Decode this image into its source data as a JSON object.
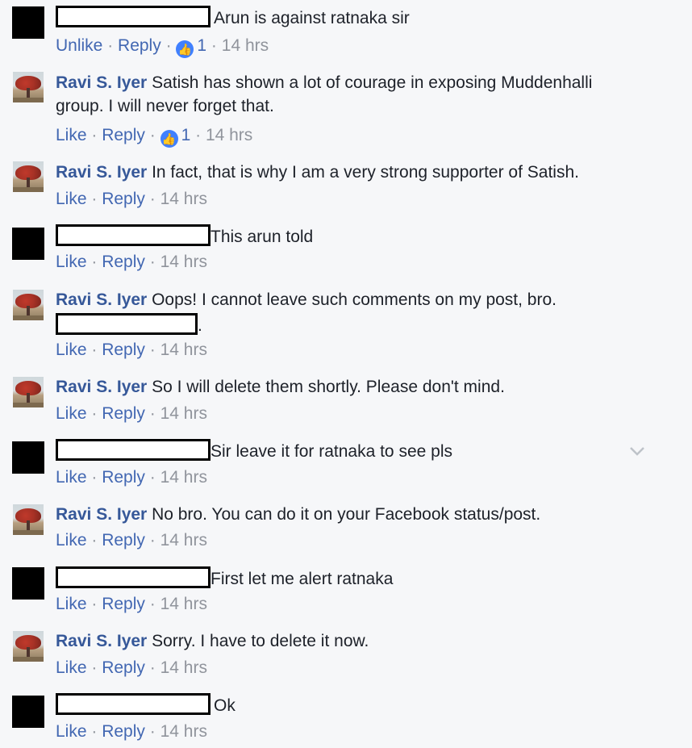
{
  "comments": [
    {
      "author": "",
      "text": "Arun is against ratnaka sir",
      "like": "Unlike",
      "reply": "Reply",
      "likes": "1",
      "time": "14 hrs"
    },
    {
      "author": "Ravi S. Iyer",
      "text": "Satish has shown a lot of courage in exposing Muddenhalli",
      "text2": "group. I will never forget that.",
      "like": "Like",
      "reply": "Reply",
      "likes": "1",
      "time": "14 hrs"
    },
    {
      "author": "Ravi S. Iyer",
      "text": "In fact, that is why I am a very strong supporter of Satish.",
      "like": "Like",
      "reply": "Reply",
      "time": "14 hrs"
    },
    {
      "author": "",
      "text": "This arun told",
      "like": "Like",
      "reply": "Reply",
      "time": "14 hrs"
    },
    {
      "author": "Ravi S. Iyer",
      "text": "Oops! I cannot leave such comments on my post, bro.",
      "text2": ".",
      "like": "Like",
      "reply": "Reply",
      "time": "14 hrs"
    },
    {
      "author": "Ravi S. Iyer",
      "text": "So I will delete them shortly. Please don't mind.",
      "like": "Like",
      "reply": "Reply",
      "time": "14 hrs"
    },
    {
      "author": "",
      "text": "Sir leave it for ratnaka to see pls",
      "like": "Like",
      "reply": "Reply",
      "time": "14 hrs"
    },
    {
      "author": "Ravi S. Iyer",
      "text": "No bro. You can do it on your Facebook status/post.",
      "like": "Like",
      "reply": "Reply",
      "time": "14 hrs"
    },
    {
      "author": "",
      "text": "First let me alert ratnaka",
      "like": "Like",
      "reply": "Reply",
      "time": "14 hrs"
    },
    {
      "author": "Ravi S. Iyer",
      "text": "Sorry. I have to delete it now.",
      "like": "Like",
      "reply": "Reply",
      "time": "14 hrs"
    },
    {
      "author": "",
      "text": "Ok",
      "like": "Like",
      "reply": "Reply",
      "time": "14 hrs"
    }
  ],
  "icons": {
    "like_badge": "thumbs-up-icon",
    "menu": "chevron-down-icon"
  },
  "colors": {
    "link": "#4267b2",
    "author": "#365899",
    "meta": "#90949c",
    "like_badge": "#4080ff"
  }
}
